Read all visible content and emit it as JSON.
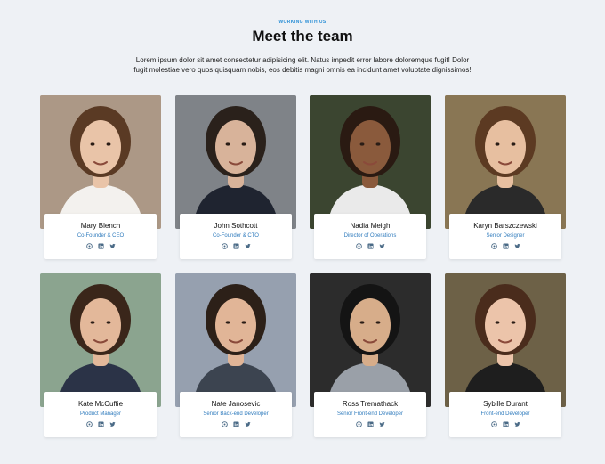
{
  "header": {
    "eyebrow": "WORKING WITH US",
    "title": "Meet the team",
    "description": "Lorem ipsum dolor sit amet consectetur adipisicing elit. Natus impedit error labore doloremque fugit! Dolor fugit molestiae vero quos quisquam nobis, eos debitis magni omnis ea incidunt amet voluptate dignissimos!"
  },
  "team": [
    {
      "name": "Mary Blench",
      "role": "Co-Founder & CEO",
      "photo": {
        "bg": "#c9b8a6",
        "bg2": "#8a7060",
        "skin": "#e9c4a8",
        "hair": "#5a3a24",
        "shirt": "#f3f1ee"
      }
    },
    {
      "name": "John Sothcott",
      "role": "Co-Founder & CTO",
      "photo": {
        "bg": "#9a9ea4",
        "bg2": "#5f6166",
        "skin": "#d8b39a",
        "hair": "#2a211b",
        "shirt": "#1f2430"
      }
    },
    {
      "name": "Nadia Meigh",
      "role": "Director of Operations",
      "photo": {
        "bg": "#4f5d3e",
        "bg2": "#23281e",
        "skin": "#8a5a3c",
        "hair": "#2a1a12",
        "shirt": "#eaeaea"
      }
    },
    {
      "name": "Karyn Barszczewski",
      "role": "Senior Designer",
      "photo": {
        "bg": "#c89b6a",
        "bg2": "#3b4a3a",
        "skin": "#e7bfa0",
        "hair": "#5c3a22",
        "shirt": "#2a2a2a"
      }
    },
    {
      "name": "Kate McCuffie",
      "role": "Product Manager",
      "photo": {
        "bg": "#b9c7c9",
        "bg2": "#557a4a",
        "skin": "#e3b89a",
        "hair": "#3a261a",
        "shirt": "#2b3347"
      }
    },
    {
      "name": "Nate Janosevic",
      "role": "Senior Back-end Developer",
      "photo": {
        "bg": "#aeb7c4",
        "bg2": "#7b8696",
        "skin": "#e1b597",
        "hair": "#2c2018",
        "shirt": "#3c4450"
      }
    },
    {
      "name": "Ross Tremathack",
      "role": "Senior Front-end Developer",
      "photo": {
        "bg": "#3a3a3a",
        "bg2": "#1c1c1c",
        "skin": "#d7ad8a",
        "hair": "#141414",
        "shirt": "#9aa0a8"
      }
    },
    {
      "name": "Sybille Durant",
      "role": "Front-end Developer",
      "photo": {
        "bg": "#8a7a58",
        "bg2": "#4a4232",
        "skin": "#ecc4aa",
        "hair": "#4a2c1c",
        "shirt": "#1e1e1e"
      }
    }
  ],
  "social_icons": [
    "github-icon",
    "linkedin-icon",
    "twitter-icon"
  ],
  "colors": {
    "accent": "#2a8fd6",
    "role": "#2f7bbd",
    "icon": "#4a6a86",
    "background": "#eef1f5"
  }
}
